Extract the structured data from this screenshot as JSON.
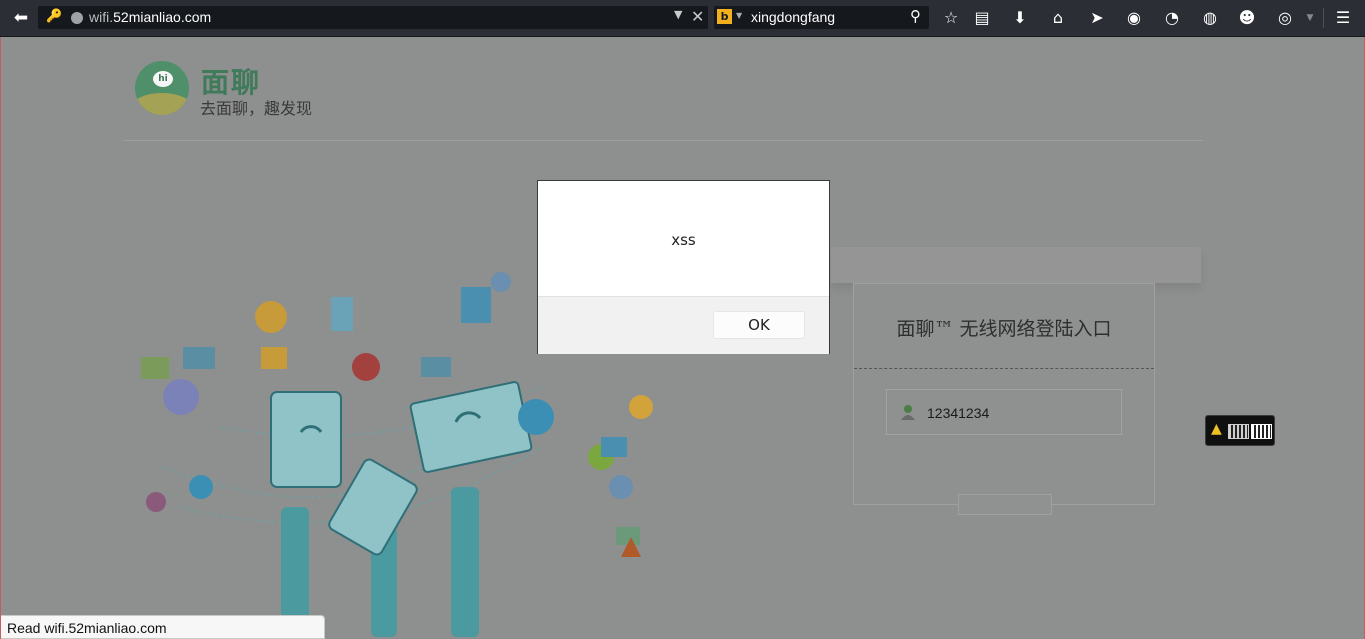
{
  "toolbar": {
    "url_prefix": "wifi.",
    "url_domain": "52mianliao.com",
    "search_query": "xingdongfang",
    "search_engine_letter": "b"
  },
  "page": {
    "logo_name": "面聊",
    "logo_hi": "hi",
    "logo_slogan": "去面聊，趣发现",
    "login_title": "面聊™ 无线网络登陆入口",
    "username_value": "12341234"
  },
  "dialog": {
    "message": "xss",
    "ok_label": "OK"
  },
  "status_bar": {
    "text": "Read wifi.52mianliao.com"
  },
  "colors": {
    "toolbar_bg": "#2b2f35",
    "overlay_page": "#8e8f8f",
    "logo_green": "#3f7a5a",
    "illustration_teal": "#4a9aa0"
  }
}
